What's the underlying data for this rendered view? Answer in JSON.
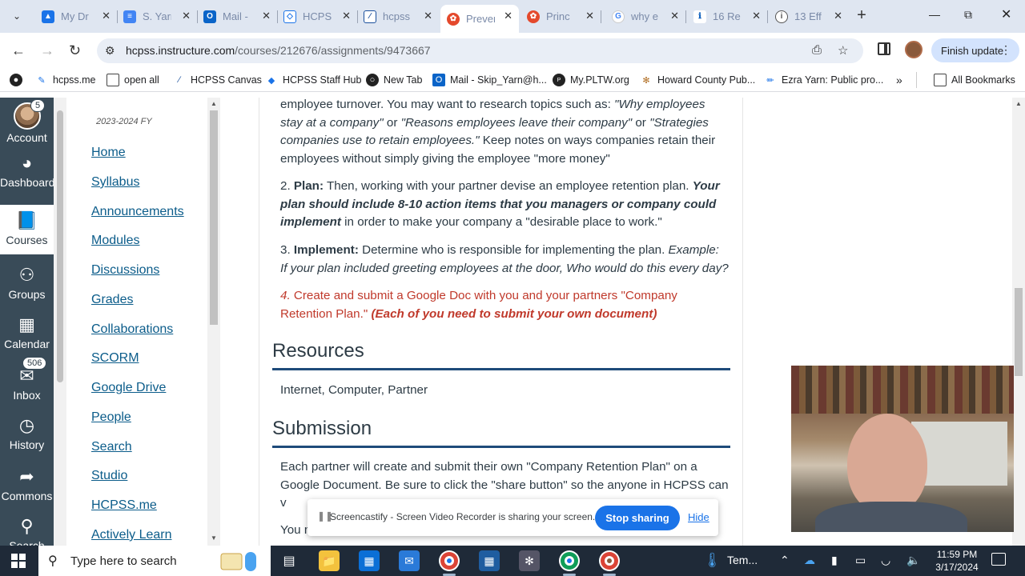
{
  "browser": {
    "tabs": [
      {
        "label": "My Dr",
        "icon": "drive-icon",
        "color": "#1a73e8"
      },
      {
        "label": "S. Yarn",
        "icon": "docs-icon",
        "color": "#4285f4"
      },
      {
        "label": "Mail -",
        "icon": "outlook-icon",
        "color": "#0a64c8"
      },
      {
        "label": "HCPSS",
        "icon": "hcpss-icon",
        "color": "#1a73e8"
      },
      {
        "label": "hcpss",
        "icon": "canvas-logo-icon",
        "color": "#1a4f9c"
      },
      {
        "label": "Preven",
        "icon": "canvas-icon",
        "color": "#e4492c"
      },
      {
        "label": "Princ",
        "icon": "canvas-icon",
        "color": "#e4492c"
      },
      {
        "label": "why e",
        "icon": "google-icon",
        "color": "#4285f4"
      },
      {
        "label": "16 Re",
        "icon": "info-icon",
        "color": "#1565c0"
      },
      {
        "label": "13 Eff",
        "icon": "info-icon",
        "color": "#555555"
      }
    ],
    "active_tab_index": 5,
    "url_host": "hcpss.instructure.com",
    "url_path": "/courses/212676/assignments/9473667",
    "finish_update_label": "Finish update",
    "bookmarks": [
      {
        "label": "",
        "icon": "circle-icon"
      },
      {
        "label": "hcpss.me",
        "icon": "hcpss-icon"
      },
      {
        "label": "open all",
        "icon": "folder-icon"
      },
      {
        "label": "HCPSS Canvas",
        "icon": "canvas-logo-icon"
      },
      {
        "label": "HCPSS Staff Hub",
        "icon": "hcpss-icon"
      },
      {
        "label": "New Tab",
        "icon": "globe-icon"
      },
      {
        "label": "Mail - Skip_Yarn@h...",
        "icon": "outlook-icon"
      },
      {
        "label": "My.PLTW.org",
        "icon": "pltw-icon"
      },
      {
        "label": "Howard County Pub...",
        "icon": "hcpss-seal-icon"
      },
      {
        "label": "Ezra Yarn: Public pro...",
        "icon": "pen-icon"
      }
    ],
    "all_bookmarks_label": "All Bookmarks"
  },
  "global_nav": {
    "items": [
      {
        "label": "Account",
        "badge": "5"
      },
      {
        "label": "Dashboard"
      },
      {
        "label": "Courses"
      },
      {
        "label": "Groups"
      },
      {
        "label": "Calendar"
      },
      {
        "label": "Inbox",
        "badge": "506"
      },
      {
        "label": "History"
      },
      {
        "label": "Commons"
      },
      {
        "label": "Search"
      }
    ],
    "active_index": 2
  },
  "course_nav": {
    "term": "2023-2024 FY",
    "links": [
      "Home",
      "Syllabus",
      "Announcements",
      "Modules",
      "Discussions",
      "Grades",
      "Collaborations",
      "SCORM",
      "Google Drive",
      "People",
      "Search",
      "Studio",
      "HCPSS.me",
      "Actively Learn"
    ]
  },
  "assignment": {
    "intro_plain1": "employee turnover. You may want to research topics such as: ",
    "intro_italic1": "\"Why employees stay at a company\"",
    "intro_plain2": " or ",
    "intro_italic2": "\"Reasons employees leave their company\"",
    "intro_plain3": " or ",
    "intro_italic3": "\"Strategies companies use to retain employees.\"",
    "intro_plain4": " Keep notes on ways companies retain their employees without simply giving the employee \"more money\"",
    "step2_num": "2.  ",
    "step2_title": "Plan:",
    "step2_plain": " Then, working with your partner devise an employee retention plan. ",
    "step2_bold_italic": "Your plan should include 8-10 action items that you managers or company could implement",
    "step2_tail": " in order to make your company a \"desirable place to work.\"",
    "step3_num": "3. ",
    "step3_title": "Implement:",
    "step3_plain": " Determine who is responsible for implementing the plan. ",
    "step3_italic": "Example: If your plan included greeting employees at the door, Who would do this every day?",
    "step4_num": "4.",
    "step4_plain": " Create and submit a Google Doc with you and your partners \"Company Retention Plan.\" ",
    "step4_bold_italic": "(Each of you need to submit your own document)",
    "resources_heading": "Resources",
    "resources_text": "Internet, Computer, Partner",
    "submission_heading": "Submission",
    "submission_text": "Each partner will create and submit their own \"Company Retention Plan\" on a Google Document. Be sure to click the \"share button\" so the anyone in HCPSS can v",
    "submission_text2": "You m"
  },
  "screencastify": {
    "message": "Screencastify - Screen Video Recorder is sharing your screen.",
    "stop_label": "Stop sharing",
    "hide_label": "Hide"
  },
  "taskbar": {
    "search_placeholder": "Type here to search",
    "weather_label": "Tem...",
    "time": "11:59 PM",
    "date": "3/17/2024"
  },
  "colors": {
    "canvas_nav": "#394b58",
    "link": "#0b5c8a",
    "accent_red": "#c0392b",
    "rule": "#1e4b7a",
    "stop_button": "#1a73e8"
  }
}
